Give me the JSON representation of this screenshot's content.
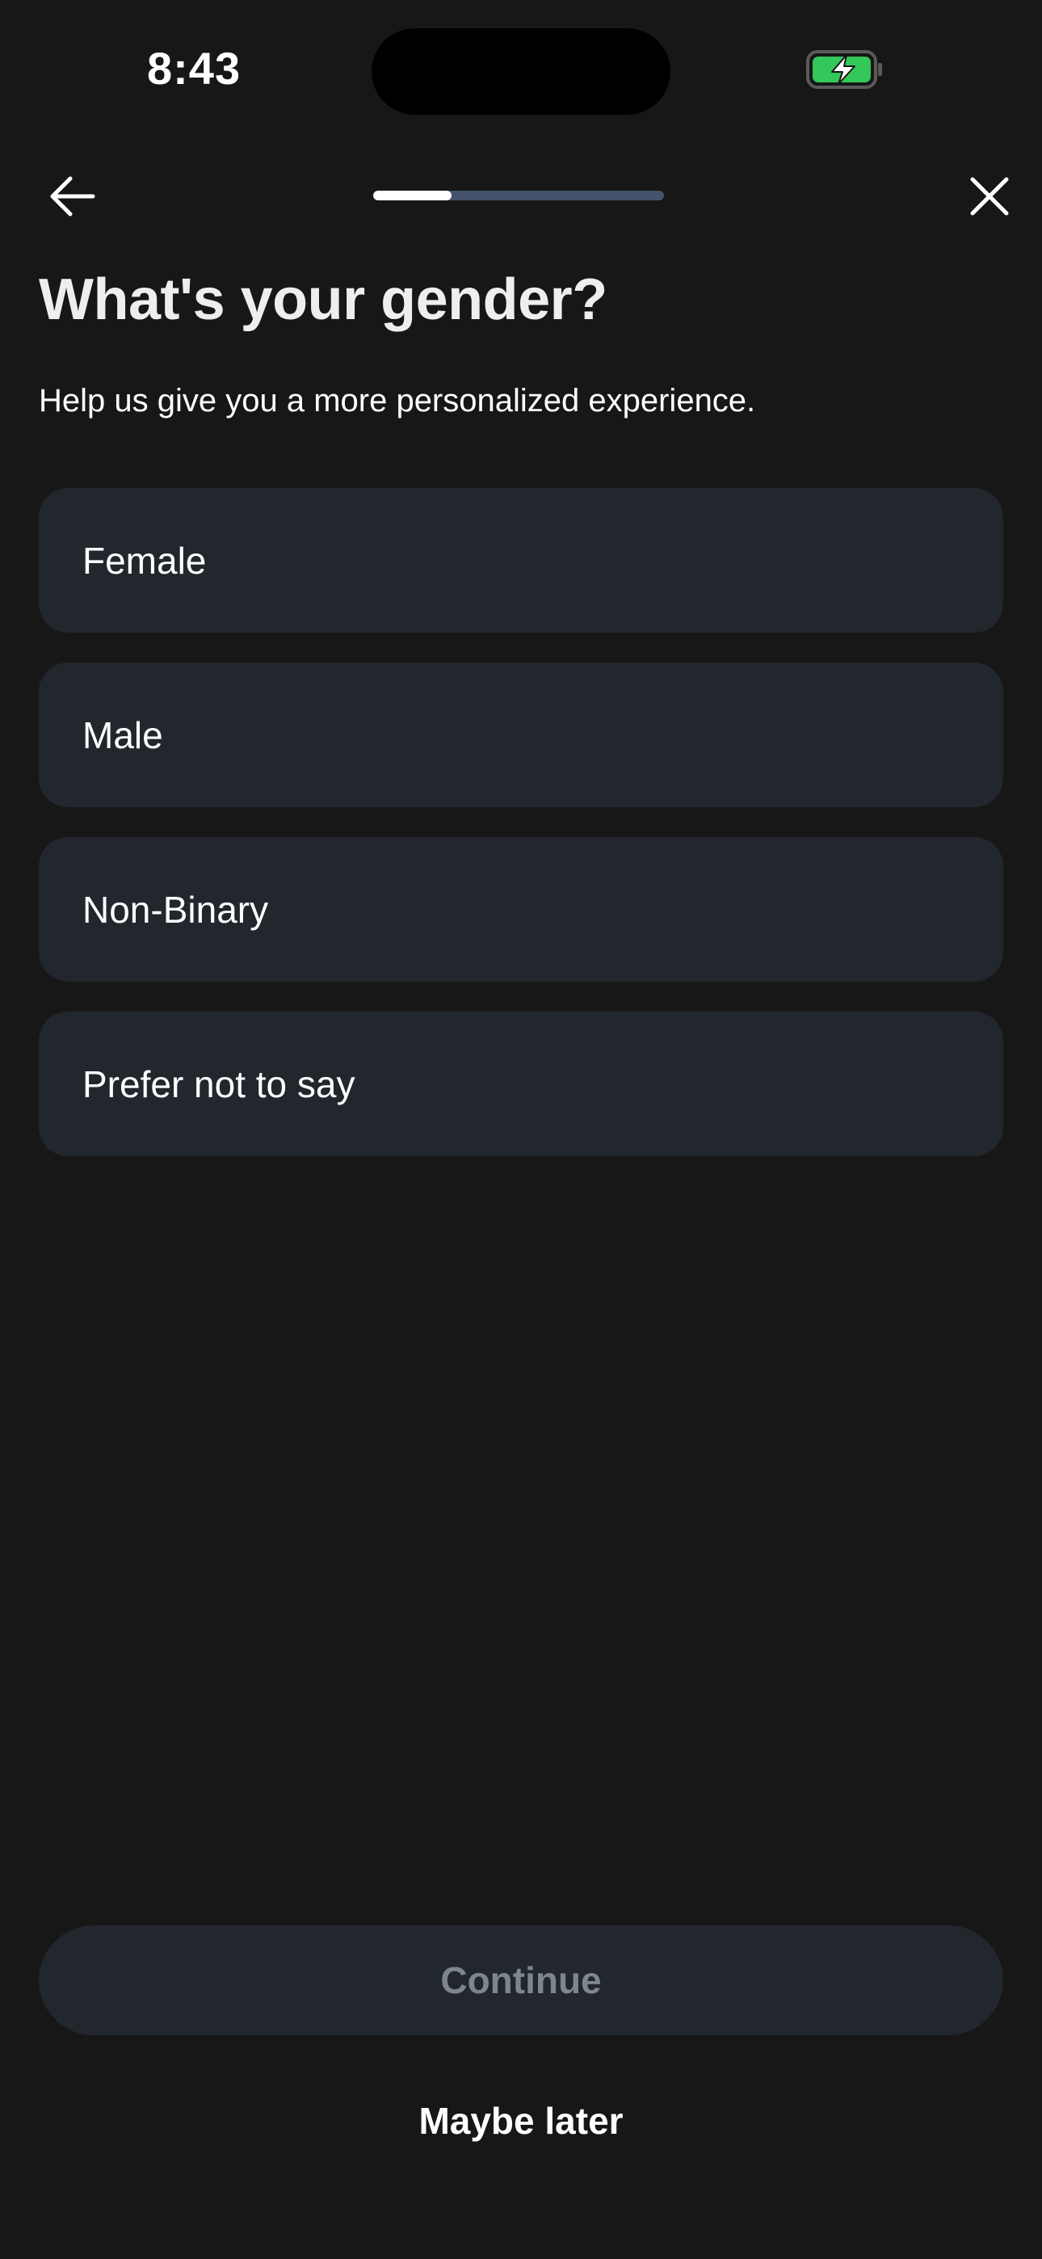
{
  "status_bar": {
    "time": "8:43",
    "battery_icon": "battery-charging-icon",
    "battery_color": "#34c759"
  },
  "nav": {
    "back_icon": "arrow-left-icon",
    "close_icon": "close-icon",
    "progress_fraction": 0.27
  },
  "header": {
    "title": "What's your gender?",
    "subtitle": "Help us give you a more personalized experience."
  },
  "options": [
    {
      "label": "Female"
    },
    {
      "label": "Male"
    },
    {
      "label": "Non-Binary"
    },
    {
      "label": "Prefer not to say"
    }
  ],
  "actions": {
    "continue_label": "Continue",
    "continue_enabled": false,
    "maybe_later_label": "Maybe later"
  },
  "colors": {
    "background": "#171717",
    "option_background": "#22262d",
    "progress_track": "#44536b",
    "disabled_text": "#7d858f"
  }
}
